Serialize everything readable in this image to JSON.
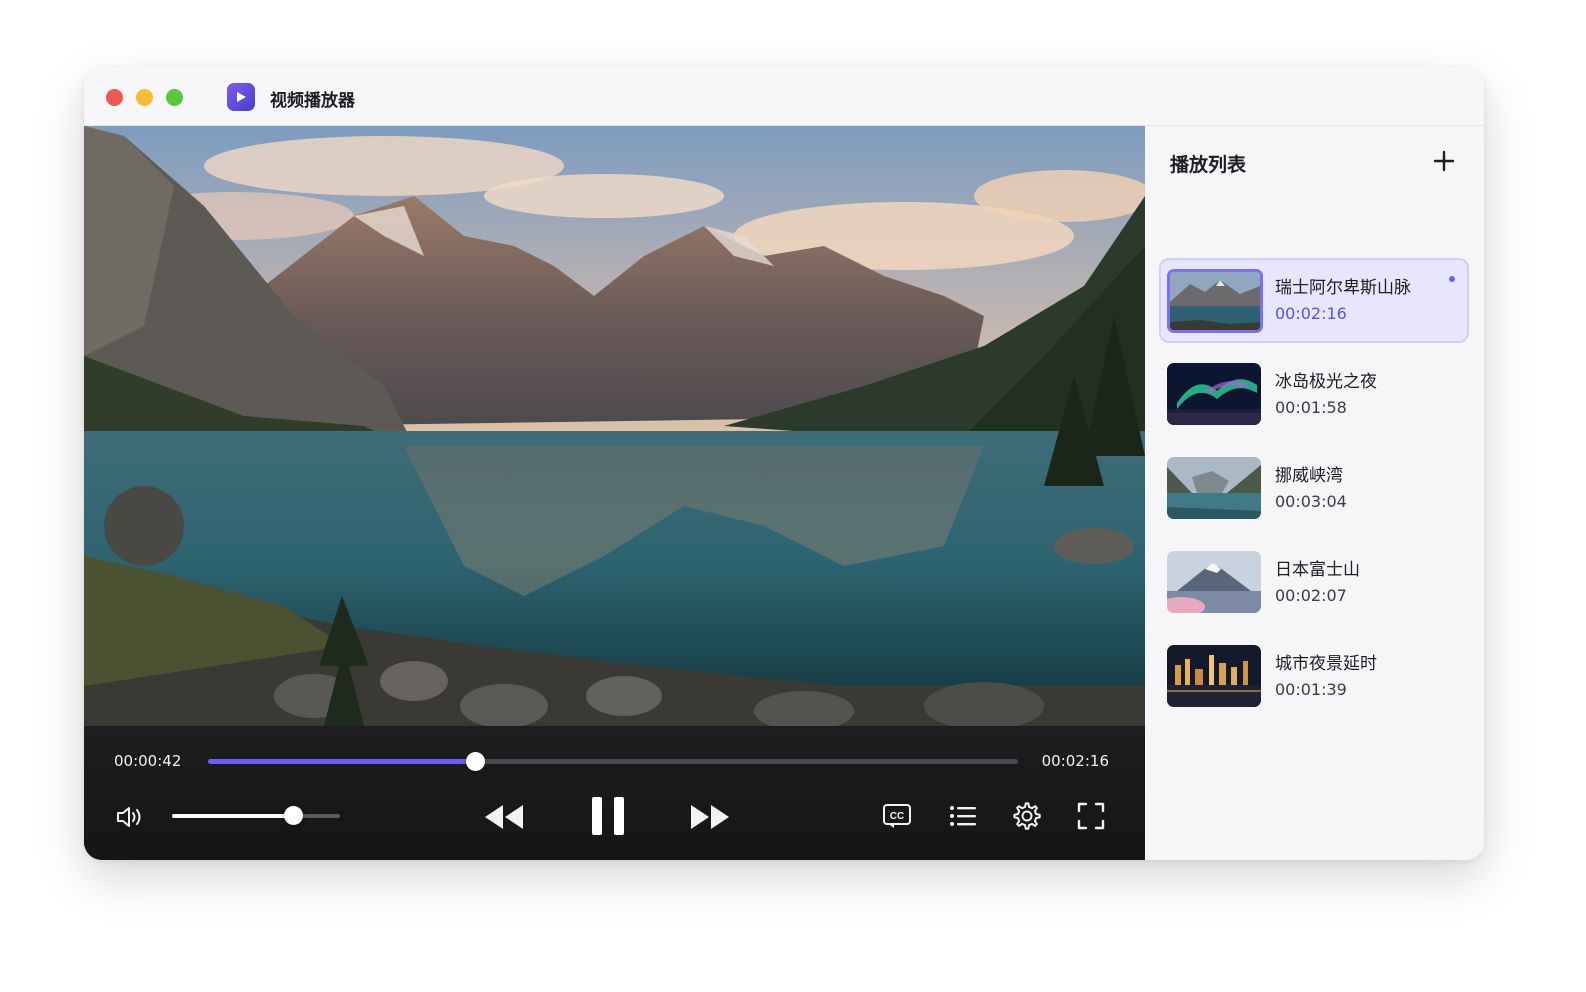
{
  "window": {
    "title": "视频播放器"
  },
  "player": {
    "current_time": "00:00:42",
    "duration": "00:02:16",
    "progress_fraction": 0.33,
    "volume_fraction": 0.72,
    "state": "playing",
    "accent_color": "#6b5ef0"
  },
  "playlist": {
    "title": "播放列表",
    "items": [
      {
        "title": "瑞士阿尔卑斯山脉",
        "duration": "00:02:16",
        "active": true
      },
      {
        "title": "冰岛极光之夜",
        "duration": "00:01:58",
        "active": false
      },
      {
        "title": "挪威峡湾",
        "duration": "00:03:04",
        "active": false
      },
      {
        "title": "日本富士山",
        "duration": "00:02:07",
        "active": false
      },
      {
        "title": "城市夜景延时",
        "duration": "00:01:39",
        "active": false
      }
    ]
  },
  "icons": {
    "volume": "speaker-icon",
    "rewind": "rewind-icon",
    "pause": "pause-icon",
    "forward": "fast-forward-icon",
    "captions": "cc-icon",
    "list": "list-icon",
    "settings": "gear-icon",
    "fullscreen": "fullscreen-icon",
    "add": "plus-icon"
  }
}
